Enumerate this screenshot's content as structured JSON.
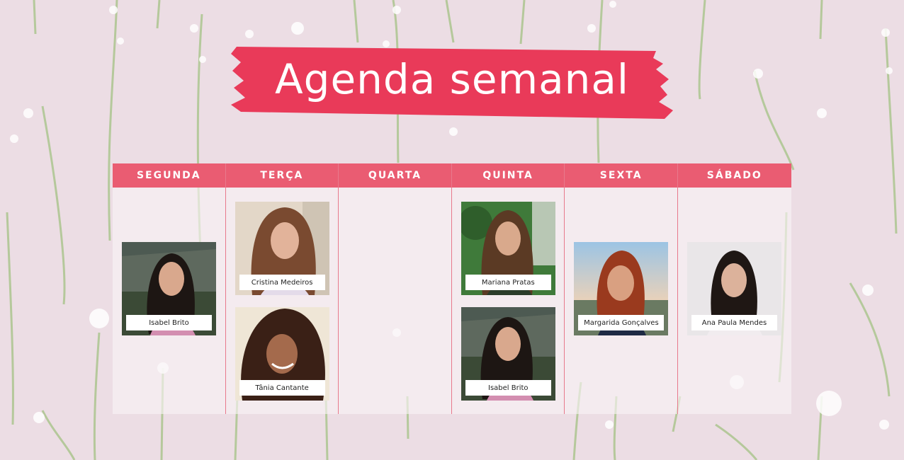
{
  "title": "Agenda semanal",
  "colors": {
    "accent": "#ea5c72",
    "banner": "#e93a59",
    "background": "#ecdde4"
  },
  "days": [
    {
      "label": "SEGUNDA",
      "people": [
        "Isabel Brito"
      ]
    },
    {
      "label": "TERÇA",
      "people": [
        "Cristina Medeiros",
        "Tânia Cantante"
      ]
    },
    {
      "label": "QUARTA",
      "people": []
    },
    {
      "label": "QUINTA",
      "people": [
        "Mariana Pratas",
        "Isabel Brito"
      ]
    },
    {
      "label": "SEXTA",
      "people": [
        "Margarida Gonçalves"
      ]
    },
    {
      "label": "SÁBADO",
      "people": [
        "Ana Paula Mendes"
      ]
    }
  ]
}
